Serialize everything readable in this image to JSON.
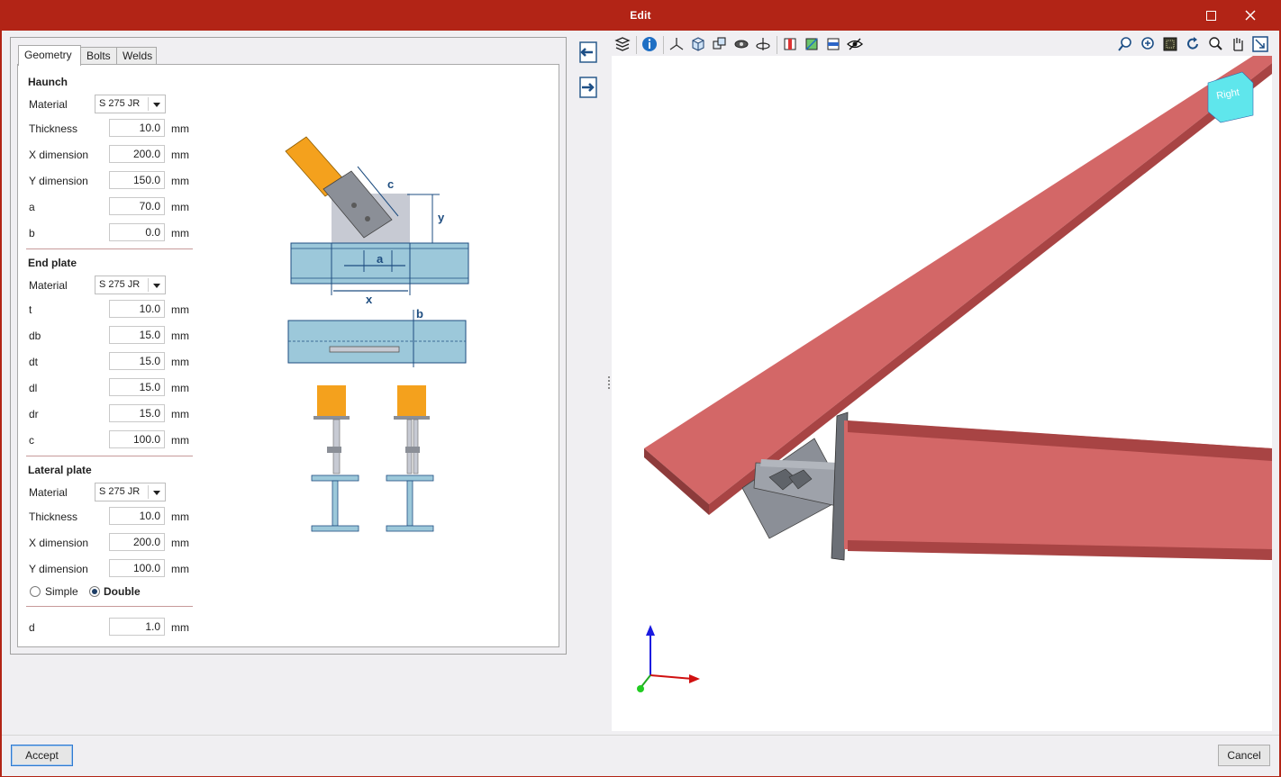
{
  "window": {
    "title": "Edit"
  },
  "tabs": [
    {
      "label": "Geometry"
    },
    {
      "label": "Bolts"
    },
    {
      "label": "Welds"
    }
  ],
  "haunch": {
    "title": "Haunch",
    "material_label": "Material",
    "material_value": "S 275 JR",
    "thickness_label": "Thickness",
    "thickness_value": "10.0",
    "xdim_label": "X dimension",
    "xdim_value": "200.0",
    "ydim_label": "Y dimension",
    "ydim_value": "150.0",
    "a_label": "a",
    "a_value": "70.0",
    "b_label": "b",
    "b_value": "0.0"
  },
  "end_plate": {
    "title": "End plate",
    "material_label": "Material",
    "material_value": "S 275 JR",
    "t_label": "t",
    "t_value": "10.0",
    "db_label": "db",
    "db_value": "15.0",
    "dt_label": "dt",
    "dt_value": "15.0",
    "dl_label": "dl",
    "dl_value": "15.0",
    "dr_label": "dr",
    "dr_value": "15.0",
    "c_label": "c",
    "c_value": "100.0"
  },
  "lateral_plate": {
    "title": "Lateral plate",
    "material_label": "Material",
    "material_value": "S 275 JR",
    "thickness_label": "Thickness",
    "thickness_value": "10.0",
    "xdim_label": "X dimension",
    "xdim_value": "200.0",
    "ydim_label": "Y dimension",
    "ydim_value": "100.0",
    "simple_label": "Simple",
    "double_label": "Double",
    "selected": "Double"
  },
  "d": {
    "label": "d",
    "value": "1.0"
  },
  "unit": "mm",
  "diagram_labels": {
    "c": "c",
    "y": "y",
    "a": "a",
    "x": "x",
    "b": "b"
  },
  "viewcube_label": "Right",
  "buttons": {
    "accept": "Accept",
    "cancel": "Cancel"
  },
  "colors": {
    "titlebar": "#b22416",
    "beam": "#d36767",
    "steel_blue": "#9cc8da",
    "orange": "#f4a11d",
    "plate_grey": "#8b8f97"
  }
}
